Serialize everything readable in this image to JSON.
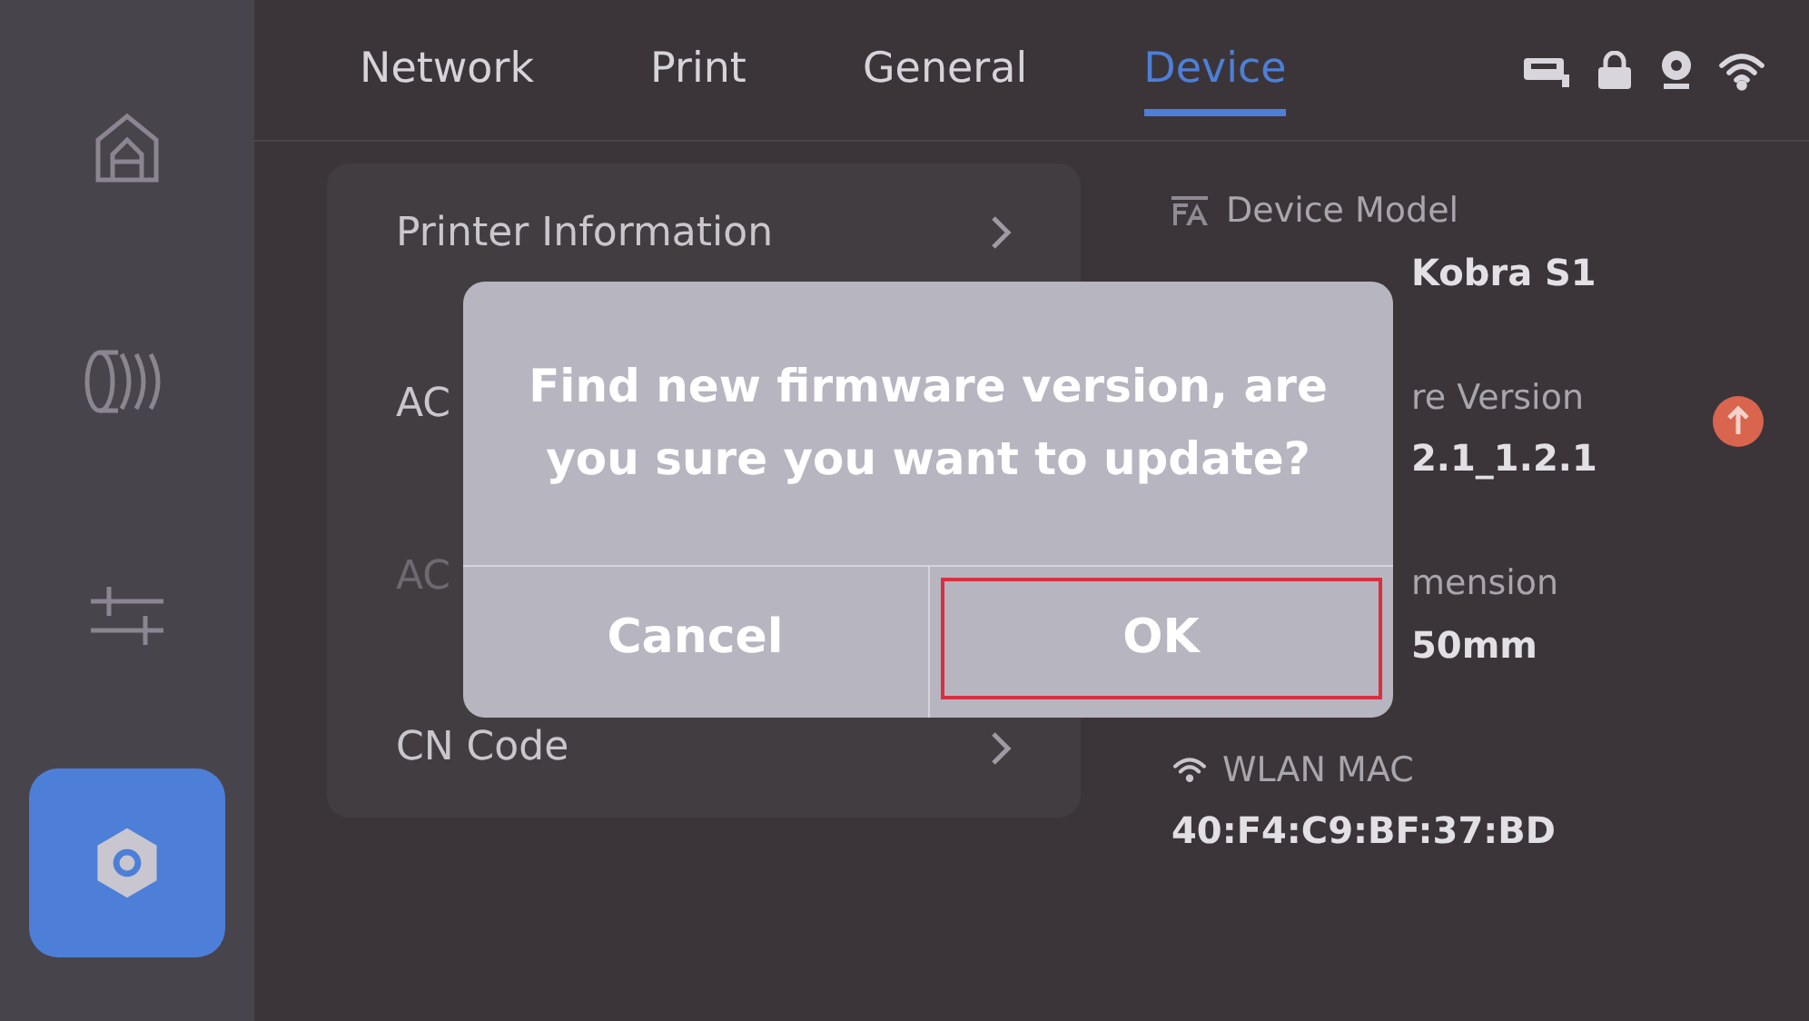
{
  "sidebar": {
    "items": [
      {
        "selected": false
      },
      {
        "selected": false
      },
      {
        "selected": false
      },
      {
        "selected": true
      }
    ]
  },
  "tabs": [
    {
      "label": "Network",
      "selected": false
    },
    {
      "label": "Print",
      "selected": false
    },
    {
      "label": "General",
      "selected": false
    },
    {
      "label": "Device",
      "selected": true
    }
  ],
  "menu": [
    {
      "label": "Printer Information",
      "chevron": true,
      "disabled": false
    },
    {
      "label": "AC",
      "disabled": false
    },
    {
      "label": "AC",
      "disabled": true
    },
    {
      "label": "CN Code",
      "chevron": true,
      "disabled": false
    }
  ],
  "info": [
    {
      "label": "Device Model",
      "value": "Kobra S1",
      "update": false
    },
    {
      "label": "re Version",
      "value": "2.1_1.2.1",
      "update": true
    },
    {
      "label": "mension",
      "value": "50mm",
      "update": false
    },
    {
      "label": "WLAN MAC",
      "value": "40:F4:C9:BF:37:BD",
      "update": false
    }
  ],
  "dialog": {
    "message": "Find new firmware version,  are you sure you want to update?",
    "buttons": [
      {
        "label": "Cancel",
        "highlighted": false
      },
      {
        "label": "OK",
        "highlighted": true
      }
    ]
  }
}
